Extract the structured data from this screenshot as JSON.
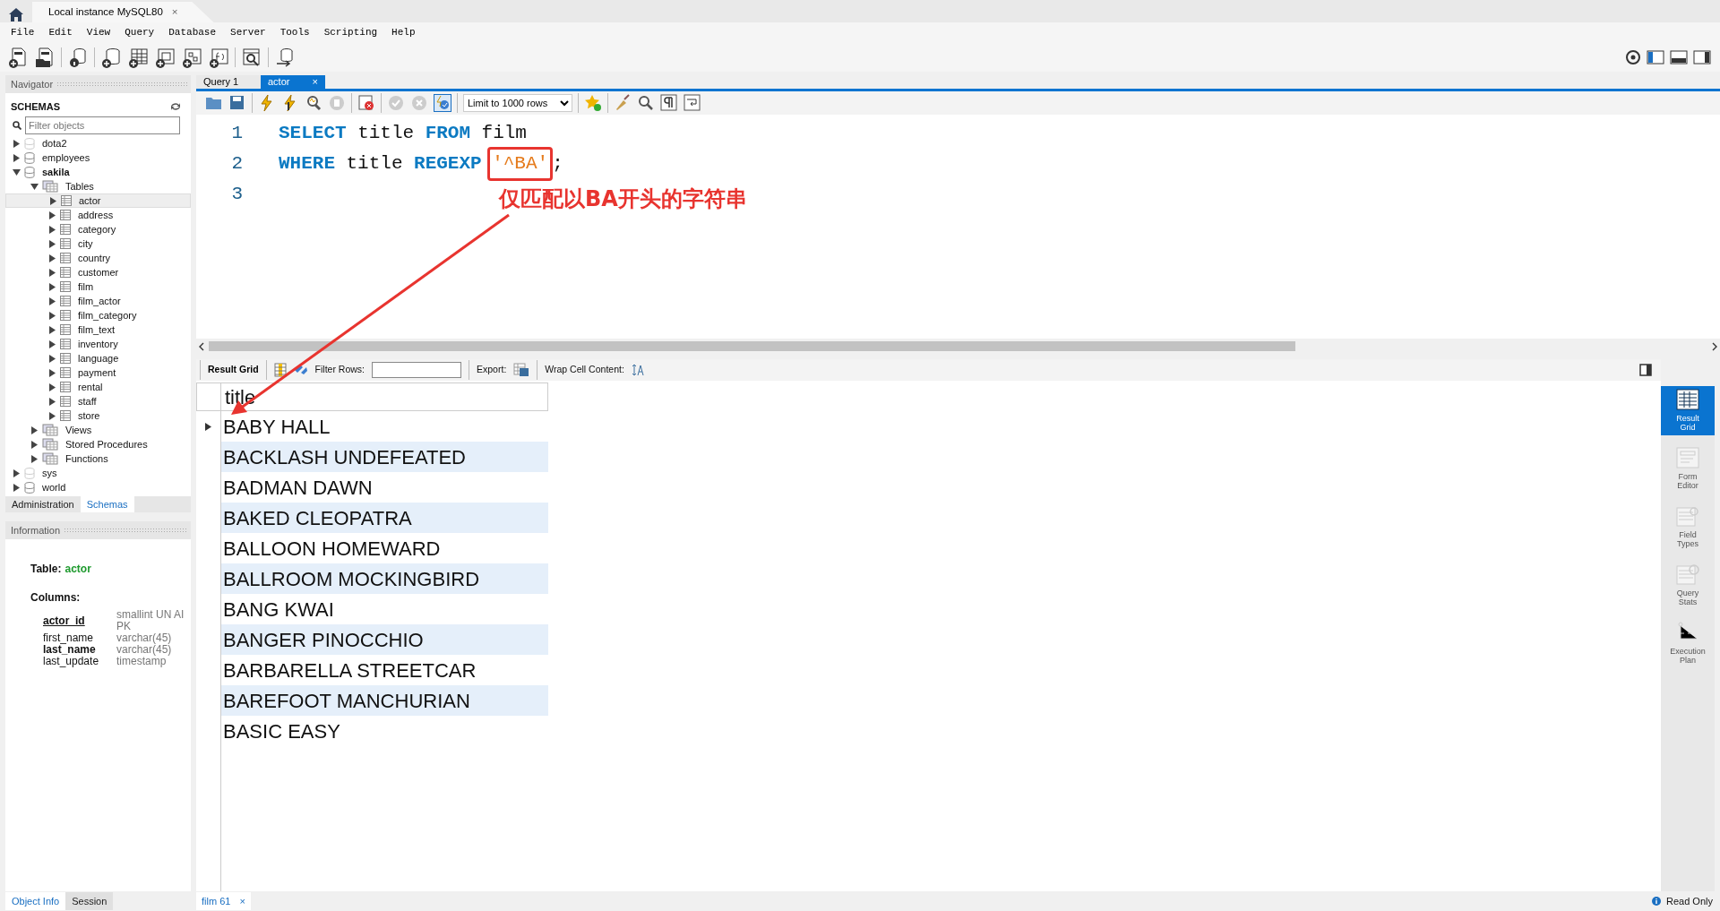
{
  "window_tabs": [
    {
      "label": "Local instance MySQL80",
      "close": "×",
      "selected": true
    }
  ],
  "menu": [
    "File",
    "Edit",
    "View",
    "Query",
    "Database",
    "Server",
    "Tools",
    "Scripting",
    "Help"
  ],
  "navigator": {
    "title": "Navigator",
    "schemas_label": "SCHEMAS",
    "filter": {
      "placeholder": "Filter objects"
    },
    "tree": [
      {
        "label": "dota2",
        "kind": "schema",
        "loaded": false,
        "default": false,
        "expanded": false,
        "selected": false
      },
      {
        "label": "employees",
        "kind": "schema",
        "loaded": true,
        "default": false,
        "expanded": false,
        "selected": false
      },
      {
        "label": "sakila",
        "kind": "schema",
        "loaded": true,
        "default": true,
        "expanded": true,
        "selected": false,
        "children": [
          {
            "label": "Tables",
            "kind": "folder",
            "expanded": true,
            "selected": false,
            "children": [
              {
                "label": "actor",
                "kind": "table",
                "expanded": false,
                "selected": true
              },
              {
                "label": "address",
                "kind": "table",
                "expanded": false,
                "selected": false
              },
              {
                "label": "category",
                "kind": "table",
                "expanded": false,
                "selected": false
              },
              {
                "label": "city",
                "kind": "table",
                "expanded": false,
                "selected": false
              },
              {
                "label": "country",
                "kind": "table",
                "expanded": false,
                "selected": false
              },
              {
                "label": "customer",
                "kind": "table",
                "expanded": false,
                "selected": false
              },
              {
                "label": "film",
                "kind": "table",
                "expanded": false,
                "selected": false
              },
              {
                "label": "film_actor",
                "kind": "table",
                "expanded": false,
                "selected": false
              },
              {
                "label": "film_category",
                "kind": "table",
                "expanded": false,
                "selected": false
              },
              {
                "label": "film_text",
                "kind": "table",
                "expanded": false,
                "selected": false
              },
              {
                "label": "inventory",
                "kind": "table",
                "expanded": false,
                "selected": false
              },
              {
                "label": "language",
                "kind": "table",
                "expanded": false,
                "selected": false
              },
              {
                "label": "payment",
                "kind": "table",
                "expanded": false,
                "selected": false
              },
              {
                "label": "rental",
                "kind": "table",
                "expanded": false,
                "selected": false
              },
              {
                "label": "staff",
                "kind": "table",
                "expanded": false,
                "selected": false
              },
              {
                "label": "store",
                "kind": "table",
                "expanded": false,
                "selected": false
              }
            ]
          },
          {
            "label": "Views",
            "kind": "folder",
            "expanded": false,
            "selected": false
          },
          {
            "label": "Stored Procedures",
            "kind": "folder",
            "expanded": false,
            "selected": false
          },
          {
            "label": "Functions",
            "kind": "folder",
            "expanded": false,
            "selected": false
          }
        ]
      },
      {
        "label": "sys",
        "kind": "schema",
        "loaded": false,
        "default": false,
        "expanded": false,
        "selected": false
      },
      {
        "label": "world",
        "kind": "schema",
        "loaded": true,
        "default": false,
        "expanded": false,
        "selected": false
      }
    ],
    "tabs": [
      {
        "label": "Administration",
        "selected": false
      },
      {
        "label": "Schemas",
        "selected": true
      }
    ]
  },
  "information": {
    "title": "Information",
    "table_label": "Table:",
    "table_name": "actor",
    "columns_label": "Columns:",
    "columns": [
      {
        "name": "actor_id",
        "type": "smallint UN AI PK",
        "kind": "primary"
      },
      {
        "name": "first_name",
        "type": "varchar(45)",
        "kind": "plain"
      },
      {
        "name": "last_name",
        "type": "varchar(45)",
        "kind": "indexed"
      },
      {
        "name": "last_update",
        "type": "timestamp",
        "kind": "plain"
      }
    ]
  },
  "bottom_tabs": [
    {
      "label": "Object Info",
      "selected": true
    },
    {
      "label": "Session",
      "selected": false
    }
  ],
  "editor_tabs": [
    {
      "label": "Query 1",
      "selected": false
    },
    {
      "label": "actor",
      "selected": true,
      "close": "×"
    }
  ],
  "limit": "Limit to 1000 rows",
  "editor": {
    "lines": [
      {
        "number": "1",
        "tokens": [
          {
            "text": "SELECT",
            "kind": "keyword"
          },
          {
            "text": "title",
            "kind": "identifier"
          },
          {
            "text": "FROM",
            "kind": "keyword"
          },
          {
            "text": "film",
            "kind": "identifier"
          }
        ]
      },
      {
        "number": "2",
        "tokens": [
          {
            "text": "WHERE",
            "kind": "keyword"
          },
          {
            "text": "title",
            "kind": "identifier"
          },
          {
            "text": "REGEXP",
            "kind": "keyword"
          },
          {
            "text": "'^BA'",
            "kind": "string",
            "boxed": true
          },
          {
            "text": ";",
            "kind": "punct"
          }
        ]
      },
      {
        "number": "3"
      }
    ],
    "annotation": "仅匹配以BA开头的字符串"
  },
  "result_toolbar": {
    "result_grid": "Result Grid",
    "filter_rows": "Filter Rows:",
    "export": "Export:",
    "wrap": "Wrap Cell Content:"
  },
  "table": {
    "columns": [
      "title"
    ],
    "rows": [
      {
        "cells": [
          "BABY HALL"
        ],
        "current": true
      },
      {
        "cells": [
          "BACKLASH UNDEFEATED"
        ],
        "current": false
      },
      {
        "cells": [
          "BADMAN DAWN"
        ],
        "current": false
      },
      {
        "cells": [
          "BAKED CLEOPATRA"
        ],
        "current": false
      },
      {
        "cells": [
          "BALLOON HOMEWARD"
        ],
        "current": false
      },
      {
        "cells": [
          "BALLROOM MOCKINGBIRD"
        ],
        "current": false
      },
      {
        "cells": [
          "BANG KWAI"
        ],
        "current": false
      },
      {
        "cells": [
          "BANGER PINOCCHIO"
        ],
        "current": false
      },
      {
        "cells": [
          "BARBARELLA STREETCAR"
        ],
        "current": false
      },
      {
        "cells": [
          "BAREFOOT MANCHURIAN"
        ],
        "current": false
      },
      {
        "cells": [
          "BASIC EASY"
        ],
        "current": false
      }
    ]
  },
  "side_panel": [
    {
      "label": "Result Grid",
      "selected": true
    },
    {
      "label": "Form Editor",
      "selected": false
    },
    {
      "label": "Field Types",
      "selected": false
    },
    {
      "label": "Query Stats",
      "selected": false
    },
    {
      "label": "Execution Plan",
      "selected": false
    }
  ],
  "result_tabs": [
    {
      "label": "film 61",
      "close": "×",
      "selected": true
    }
  ],
  "status": "Read Only"
}
